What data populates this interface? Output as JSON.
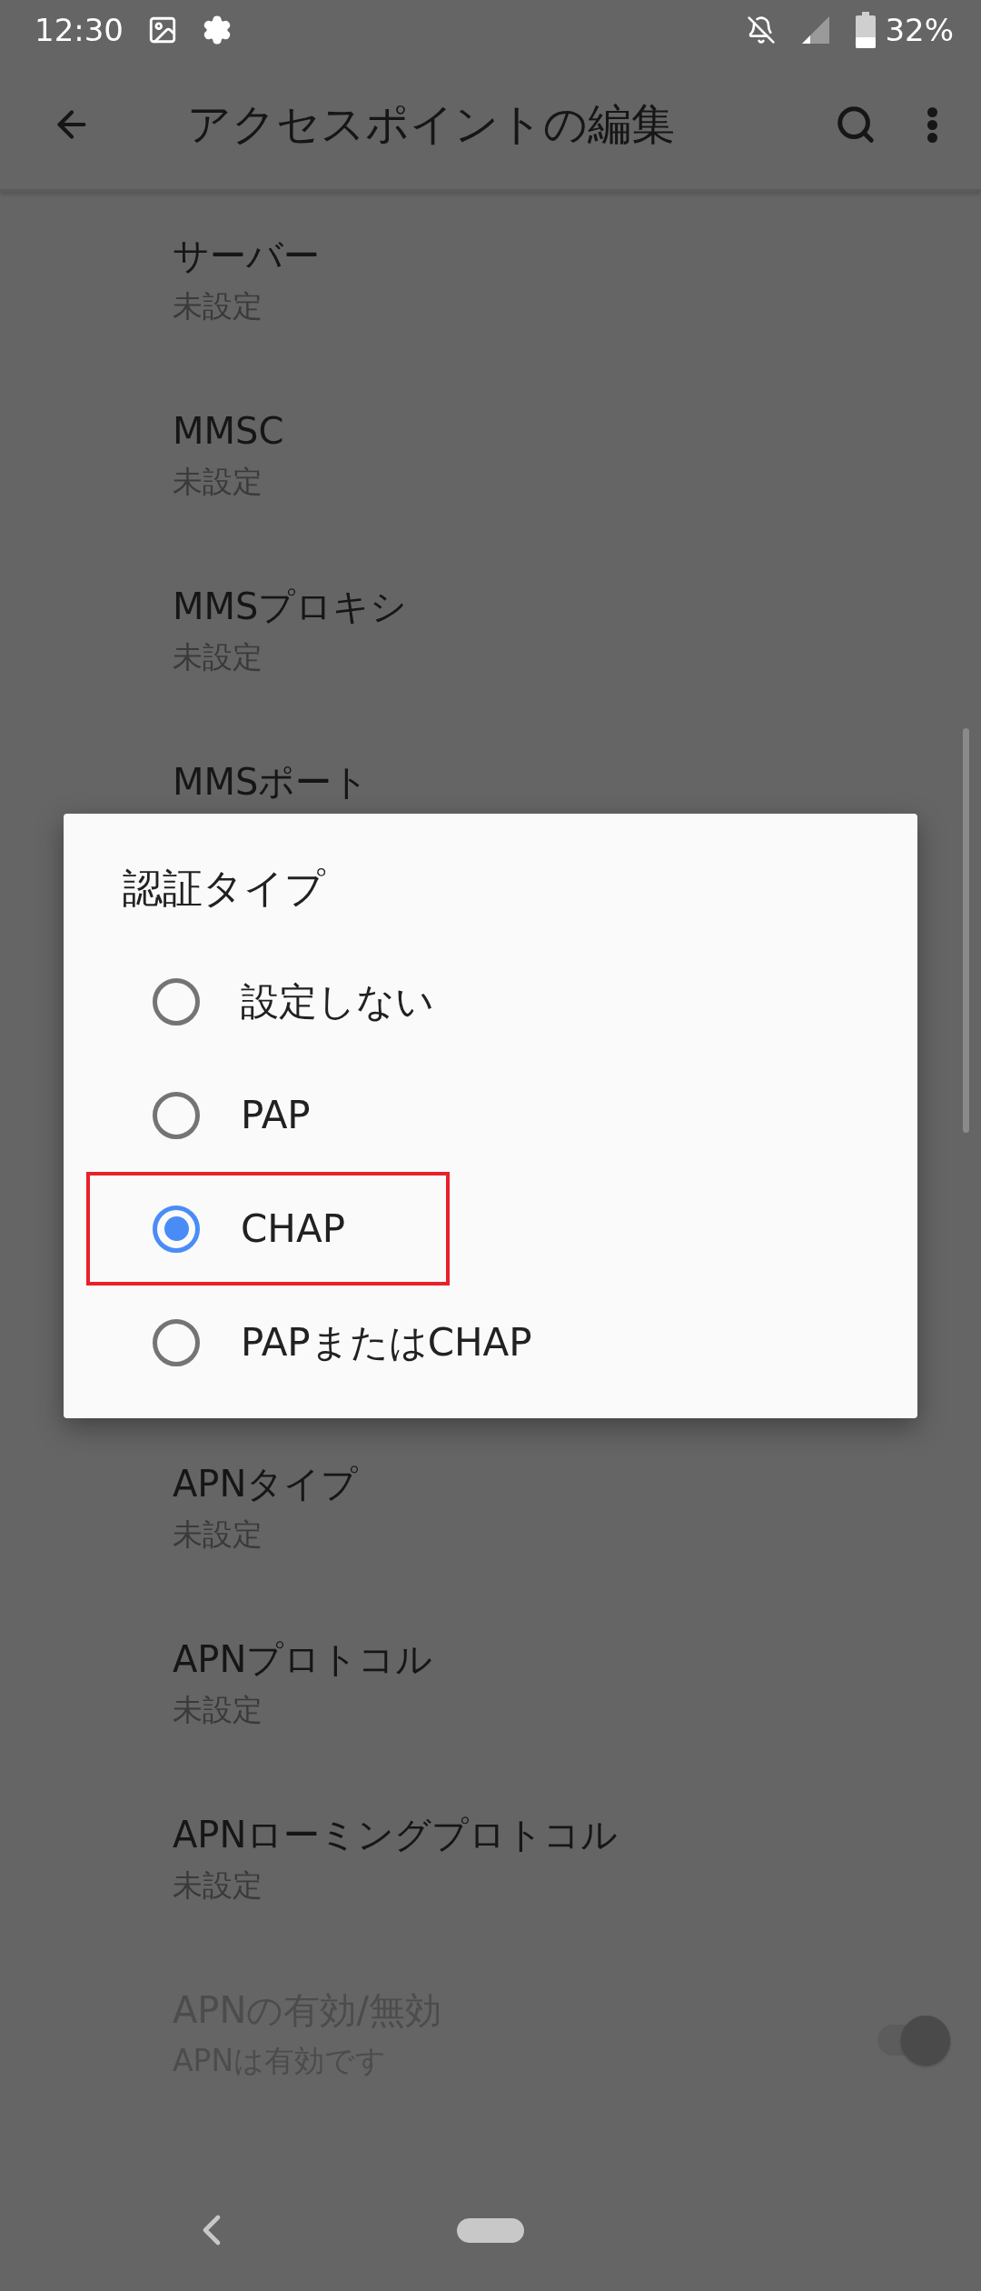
{
  "status_bar": {
    "time": "12:30",
    "battery": "32%"
  },
  "app_bar": {
    "title": "アクセスポイントの編集"
  },
  "settings_above": [
    {
      "title": "サーバー",
      "value": "未設定"
    },
    {
      "title": "MMSC",
      "value": "未設定"
    },
    {
      "title": "MMSプロキシ",
      "value": "未設定"
    },
    {
      "title": "MMSポート"
    }
  ],
  "settings_below": [
    {
      "kind": "text",
      "title": "APNタイプ",
      "value": "未設定"
    },
    {
      "kind": "text",
      "title": "APNプロトコル",
      "value": "未設定"
    },
    {
      "kind": "text",
      "title": "APNローミングプロトコル",
      "value": "未設定"
    },
    {
      "kind": "switch",
      "title": "APNの有効/無効",
      "value": "APNは有効です",
      "on": true,
      "disabled": true
    }
  ],
  "dialog": {
    "title": "認証タイプ",
    "options": [
      {
        "label": "設定しない",
        "selected": false,
        "highlighted": false
      },
      {
        "label": "PAP",
        "selected": false,
        "highlighted": false
      },
      {
        "label": "CHAP",
        "selected": true,
        "highlighted": true
      },
      {
        "label": "PAPまたはCHAP",
        "selected": false,
        "highlighted": false
      }
    ]
  }
}
